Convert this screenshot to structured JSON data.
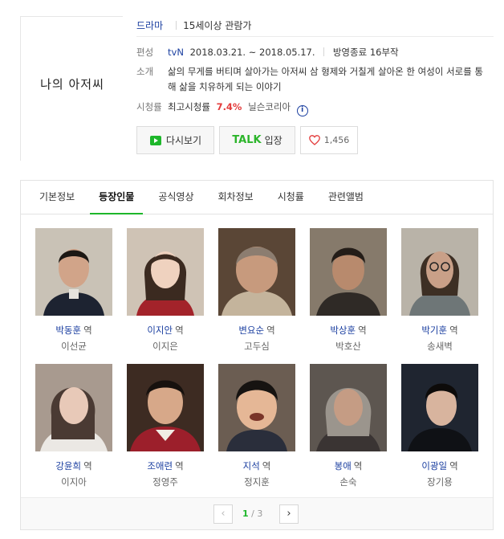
{
  "header": {
    "poster_title": "나의 아저씨",
    "genre": "드라마",
    "age_rating": "15세이상 관람가",
    "schedule_label": "편성",
    "channel": "tvN",
    "dates": "2018.03.21. ~ 2018.05.17.",
    "status": "방영종료 16부작",
    "intro_label": "소개",
    "intro": "삶의 무게를 버티며 살아가는 아저씨 삼 형제와 거칠게 살아온 한 여성이 서로를 통해 삶을 치유하게 되는 이야기",
    "ratings_label": "시청률",
    "ratings_prefix": "최고시청률",
    "ratings_value": "7.4%",
    "ratings_source": "닐슨코리아",
    "info_icon_glyph": "i"
  },
  "buttons": {
    "replay_label": "다시보기",
    "talk_word": "TALK",
    "talk_label": "입장",
    "like_count": "1,456"
  },
  "tabs": [
    {
      "label": "기본정보"
    },
    {
      "label": "등장인물",
      "active": true
    },
    {
      "label": "공식영상"
    },
    {
      "label": "회차정보"
    },
    {
      "label": "시청률"
    },
    {
      "label": "관련앨범"
    }
  ],
  "cast_suffix": "역",
  "cast": [
    {
      "role": "박동훈",
      "actor": "이선균"
    },
    {
      "role": "이지안",
      "actor": "이지은"
    },
    {
      "role": "변요순",
      "actor": "고두심"
    },
    {
      "role": "박상훈",
      "actor": "박호산"
    },
    {
      "role": "박기훈",
      "actor": "송새벽"
    },
    {
      "role": "강윤희",
      "actor": "이지아"
    },
    {
      "role": "조애련",
      "actor": "정영주"
    },
    {
      "role": "지석",
      "actor": "정지훈"
    },
    {
      "role": "봉애",
      "actor": "손숙"
    },
    {
      "role": "이광일",
      "actor": "장기용"
    }
  ],
  "pager": {
    "current": "1",
    "separator": "/",
    "total": "3",
    "prev_glyph": "‹",
    "next_glyph": "›"
  },
  "colors": {
    "link_blue": "#1b3fa0",
    "accent_green": "#1eb72b",
    "talk_green": "#2cb52b",
    "highlight_red": "#e33b3b"
  }
}
